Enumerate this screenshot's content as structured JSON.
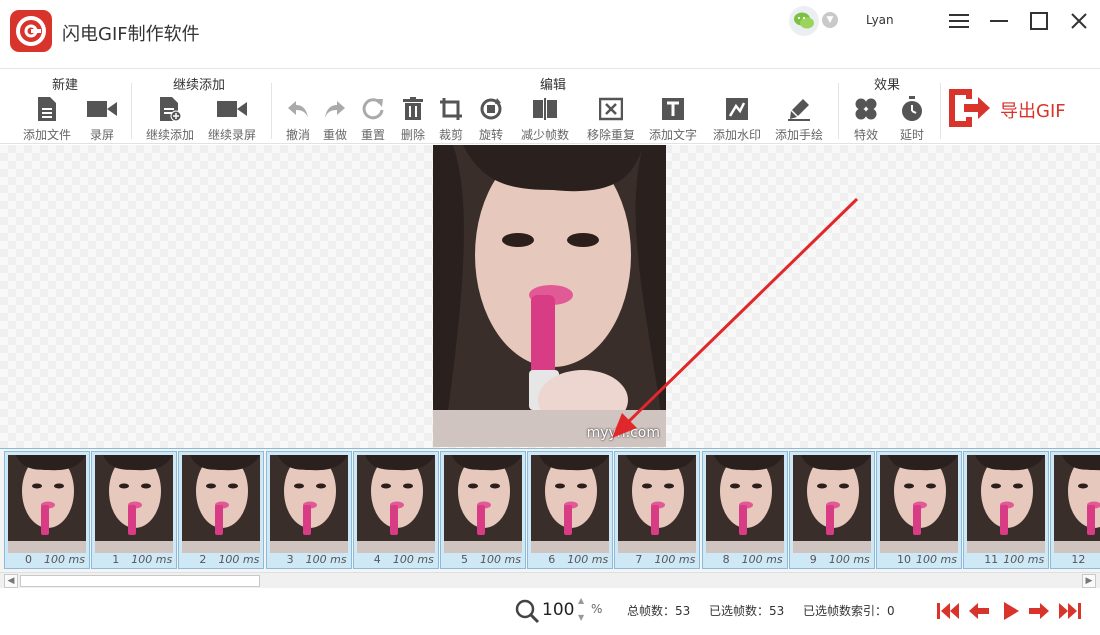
{
  "app": {
    "title": "闪电GIF制作软件",
    "username": "Lyan"
  },
  "toolbar": {
    "groups": {
      "new": "新建",
      "continue": "继续添加",
      "edit": "编辑",
      "effects": "效果"
    },
    "items": {
      "add_file": "添加文件",
      "record": "录屏",
      "continue_add": "继续添加",
      "continue_record": "继续录屏",
      "undo": "撤消",
      "redo": "重做",
      "reset": "重置",
      "delete": "删除",
      "crop": "裁剪",
      "rotate": "旋转",
      "reduce_frames": "减少帧数",
      "remove_dup": "移除重复",
      "add_text": "添加文字",
      "add_watermark": "添加水印",
      "add_drawing": "添加手绘",
      "effects": "特效",
      "delay": "延时"
    },
    "export_label": "导出GIF"
  },
  "preview": {
    "watermark": "myyh.com"
  },
  "filmstrip": {
    "frames": [
      {
        "index": "0",
        "duration": "100 ms"
      },
      {
        "index": "1",
        "duration": "100 ms"
      },
      {
        "index": "2",
        "duration": "100 ms"
      },
      {
        "index": "3",
        "duration": "100 ms"
      },
      {
        "index": "4",
        "duration": "100 ms"
      },
      {
        "index": "5",
        "duration": "100 ms"
      },
      {
        "index": "6",
        "duration": "100 ms"
      },
      {
        "index": "7",
        "duration": "100 ms"
      },
      {
        "index": "8",
        "duration": "100 ms"
      },
      {
        "index": "9",
        "duration": "100 ms"
      },
      {
        "index": "10",
        "duration": "100 ms"
      },
      {
        "index": "11",
        "duration": "100 ms"
      },
      {
        "index": "12",
        "duration": ""
      }
    ]
  },
  "status": {
    "zoom": "100",
    "zoom_unit": "%",
    "total_frames": "总帧数：53",
    "selected_frames": "已选帧数：53",
    "selected_index": "已选帧数索引：0"
  },
  "colors": {
    "accent": "#d9342b",
    "frame_border": "#8bbbd8",
    "frame_bg": "#cfe8f6"
  }
}
